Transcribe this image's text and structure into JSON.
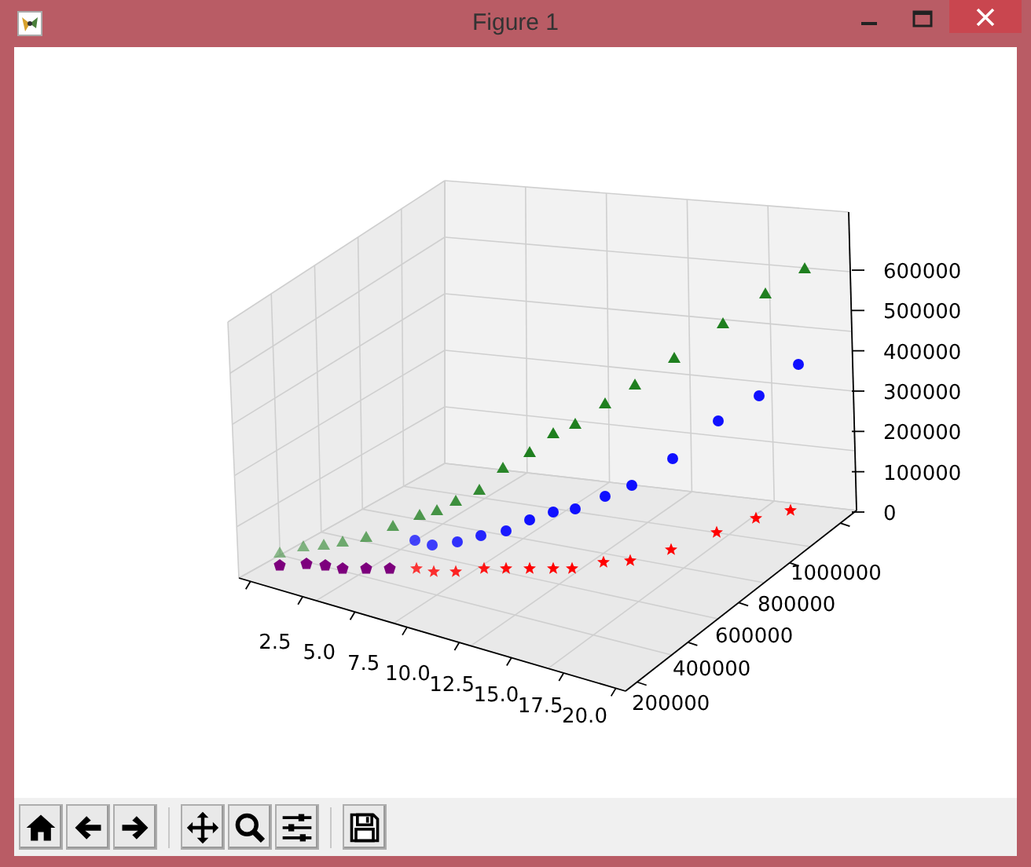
{
  "window": {
    "title": "Figure 1"
  },
  "plot": {
    "x_ticks": [
      "2.5",
      "5.0",
      "7.5",
      "10.0",
      "12.5",
      "15.0",
      "17.5",
      "20.0"
    ],
    "y_ticks": [
      "1000000",
      "800000",
      "600000",
      "400000",
      "200000"
    ],
    "z_ticks": [
      "600000",
      "500000",
      "400000",
      "300000",
      "200000",
      "100000",
      "0"
    ]
  },
  "toolbar": [
    {
      "kind": "home"
    },
    {
      "kind": "back"
    },
    {
      "kind": "forward"
    },
    {
      "kind": "separator"
    },
    {
      "kind": "pan"
    },
    {
      "kind": "zoom"
    },
    {
      "kind": "configure"
    },
    {
      "kind": "separator"
    },
    {
      "kind": "save"
    }
  ]
}
